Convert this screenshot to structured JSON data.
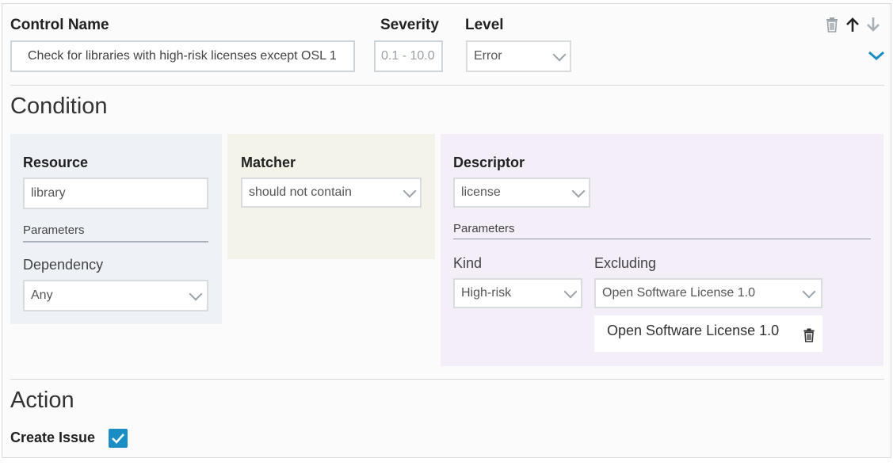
{
  "header": {
    "control_name_label": "Control Name",
    "control_name_value": "Check for libraries with high-risk licenses except OSL 1",
    "severity_label": "Severity",
    "severity_placeholder": "0.1 - 10.0",
    "level_label": "Level",
    "level_value": "Error",
    "actions": [
      "trash-icon",
      "arrow-up-icon",
      "arrow-down-icon",
      "chevron-down-icon"
    ]
  },
  "condition": {
    "title": "Condition",
    "resource": {
      "label": "Resource",
      "value": "library",
      "parameters_label": "Parameters",
      "dependency_label": "Dependency",
      "dependency_value": "Any"
    },
    "matcher": {
      "label": "Matcher",
      "value": "should not contain"
    },
    "descriptor": {
      "label": "Descriptor",
      "value": "license",
      "parameters_label": "Parameters",
      "kind_label": "Kind",
      "kind_value": "High-risk",
      "excluding_label": "Excluding",
      "excluding_value": "Open Software License 1.0",
      "excluded_items": [
        "Open Software License 1.0"
      ]
    }
  },
  "action": {
    "title": "Action",
    "create_issue_label": "Create Issue",
    "create_issue_checked": true
  },
  "colors": {
    "accent": "#1a8ec4",
    "resource_bg": "#eef2f6",
    "matcher_bg": "#f3f3ea",
    "descriptor_bg": "#f3eef8"
  }
}
